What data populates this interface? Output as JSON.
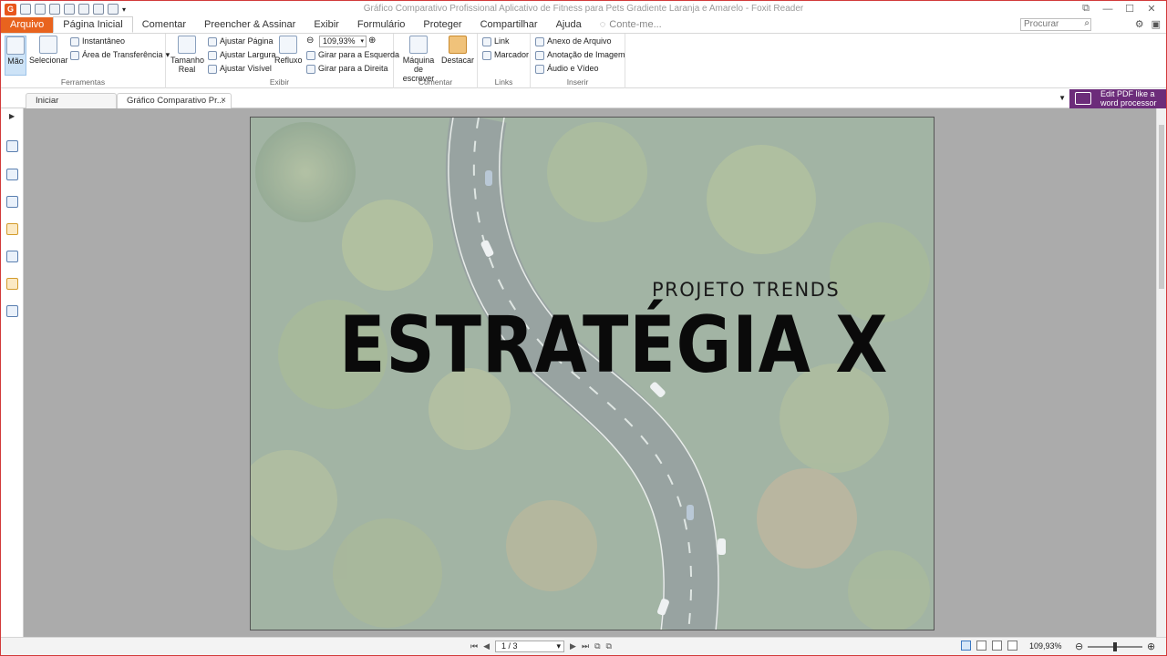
{
  "window": {
    "title": "Gráfico Comparativo Profissional Aplicativo de Fitness para Pets Gradiente Laranja e Amarelo - Foxit Reader"
  },
  "tabs": {
    "file": "Arquivo",
    "items": [
      "Página Inicial",
      "Comentar",
      "Preencher & Assinar",
      "Exibir",
      "Formulário",
      "Proteger",
      "Compartilhar",
      "Ajuda"
    ],
    "tell_me": "Conte-me...",
    "search_placeholder": "Procurar"
  },
  "ribbon": {
    "ferramentas": {
      "label": "Ferramentas",
      "hand": "Mão",
      "select": "Selecionar",
      "snapshot": "Instantâneo",
      "clipboard": "Área de Transferência"
    },
    "exibir": {
      "label": "Exibir",
      "actual_size_1": "Tamanho",
      "actual_size_2": "Real",
      "fit_page": "Ajustar Página",
      "fit_width": "Ajustar Largura",
      "fit_visible": "Ajustar Visível",
      "reflow": "Refluxo",
      "zoom_value": "109,93%",
      "rotate_left": "Girar para a Esquerda",
      "rotate_right": "Girar para a Direita"
    },
    "comentar": {
      "label": "Comentar",
      "typewriter_1": "Máquina de",
      "typewriter_2": "escrever",
      "highlight": "Destacar"
    },
    "links": {
      "label": "Links",
      "link": "Link",
      "bookmark": "Marcador"
    },
    "inserir": {
      "label": "Inserir",
      "file_attachment": "Anexo de Arquivo",
      "image_annotation": "Anotação de Imagem",
      "audio_video": "Áudio e Vídeo"
    }
  },
  "doc_tabs": {
    "start": "Iniciar",
    "current": "Gráfico Comparativo Pr...",
    "close": "×"
  },
  "promo": {
    "line1": "Edit PDF like a",
    "line2": "word processor"
  },
  "document": {
    "subtitle": "PROJETO TRENDS",
    "headline": "ESTRATÉGIA X"
  },
  "status": {
    "page_indicator": "1 / 3",
    "zoom": "109,93%"
  },
  "colors": {
    "file_tab": "#e8631e",
    "promo_bg": "#6c2c7a",
    "workspace": "#ababab",
    "selected_tool": "#cde3f7"
  }
}
